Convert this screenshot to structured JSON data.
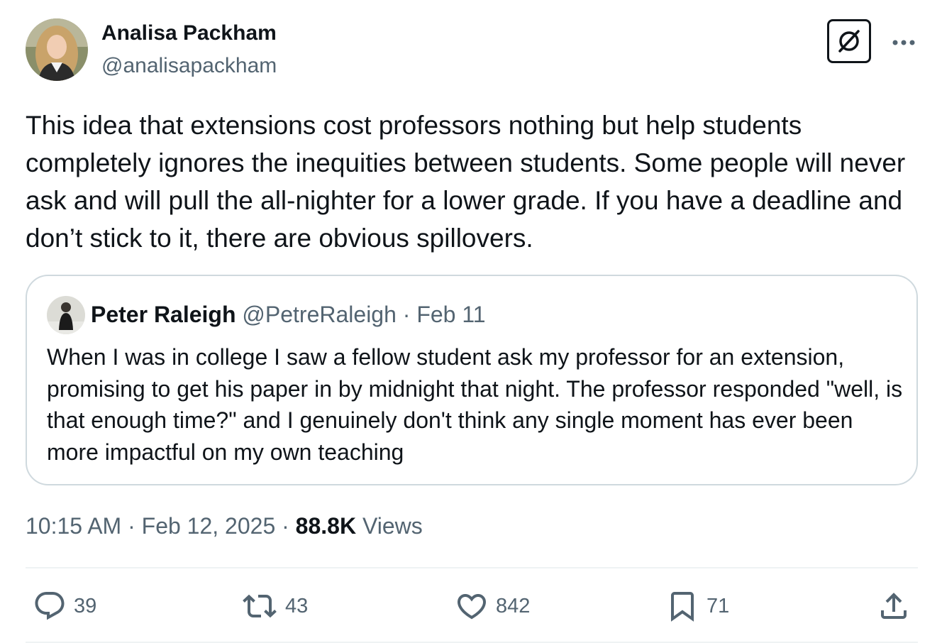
{
  "author": {
    "name": "Analisa Packham",
    "handle": "@analisapackham",
    "avatar_icon": "profile-photo"
  },
  "tweet": {
    "text": "This idea that extensions cost professors nothing but help students completely ignores the inequities between students. Some people will never ask and will pull the all-nighter for a lower grade. If you have a deadline and don’t stick to it, there are obvious spillovers."
  },
  "quote": {
    "name": "Peter Raleigh",
    "handle": "@PetreRaleigh",
    "separator": " · ",
    "date": "Feb 11",
    "text": "When I was in college I saw a fellow student ask my professor for an extension, promising to get his paper in by midnight that night. The professor responded \"well, is that enough time?\" and I genuinely don't think any single moment has ever been more impactful on my own teaching"
  },
  "meta": {
    "time": "10:15 AM",
    "separator": " · ",
    "date": "Feb 12, 2025",
    "views_count": "88.8K",
    "views_label": "Views"
  },
  "actions": {
    "replies": "39",
    "reposts": "43",
    "likes": "842",
    "bookmarks": "71"
  },
  "icons": {
    "grok": "grok-icon",
    "more": "more-icon",
    "reply": "reply-icon",
    "repost": "repost-icon",
    "like": "heart-icon",
    "bookmark": "bookmark-icon",
    "share": "share-icon"
  },
  "colors": {
    "text": "#0f1419",
    "secondary": "#536471",
    "border": "#cfd9de",
    "divider": "#eff3f4"
  }
}
